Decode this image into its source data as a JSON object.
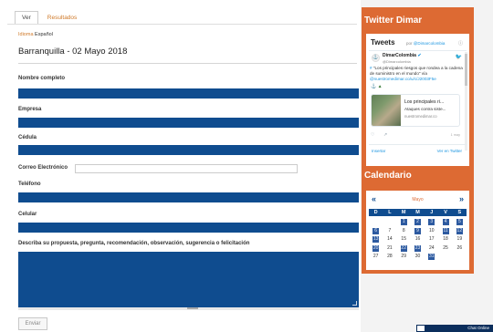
{
  "tabs": [
    {
      "label": "Ver",
      "active": true
    },
    {
      "label": "Resultados",
      "active": false
    }
  ],
  "languages": {
    "active": "Idioma",
    "other": "Español"
  },
  "form": {
    "title": "Barranquilla - 02 Mayo 2018",
    "fields": {
      "nombre": "Nombre completo",
      "empresa": "Empresa",
      "cedula": "Cédula",
      "correo": "Correo Electrónico",
      "telefono": "Teléfono",
      "celular": "Celular",
      "propuesta": "Describa su propuesta, pregunta, recomendación, observación, sugerencia o felicitación"
    },
    "submit_label": "Enviar",
    "field_color": "#0f4c8f"
  },
  "sidebar": {
    "accent": "#dd6a33",
    "twitter_heading": "Twitter Dimar",
    "calendar_heading": "Calendario"
  },
  "twitter": {
    "title": "Tweets",
    "by_prefix": "por",
    "by_handle": "@Dimarcolombia",
    "info_icon": "info-icon",
    "account_name": "DimarColombia",
    "account_handle": "@Dimarcolombia",
    "tweet_prefix": "#",
    "tweet_quote": "\"Los principales riesgos que rondea a la cadena de suministro en el mundo\"",
    "tweet_via": "vía",
    "tweet_link": "@nuestromedimar.co/u/c/J2003F5e",
    "card_title": "Los principales ri...",
    "card_subtitle": "Ataques contra siste...",
    "card_domain": "nuestromedimar.co",
    "date": "1 may",
    "embed_label": "Insertar",
    "view_label": "Ver en Twitter"
  },
  "calendar": {
    "month": "Mayo",
    "prev_label": "«",
    "next_label": "»",
    "days": [
      "D",
      "L",
      "M",
      "M",
      "J",
      "V",
      "S"
    ],
    "rows": [
      [
        {
          "d": "",
          "ev": false
        },
        {
          "d": "",
          "ev": false
        },
        {
          "d": "1",
          "ev": true
        },
        {
          "d": "2",
          "ev": true
        },
        {
          "d": "3",
          "ev": true
        },
        {
          "d": "4",
          "ev": true
        },
        {
          "d": "5",
          "ev": true
        }
      ],
      [
        {
          "d": "6",
          "ev": true
        },
        {
          "d": "7",
          "ev": false
        },
        {
          "d": "8",
          "ev": false
        },
        {
          "d": "9",
          "ev": true
        },
        {
          "d": "10",
          "ev": false
        },
        {
          "d": "11",
          "ev": true
        },
        {
          "d": "12",
          "ev": true
        }
      ],
      [
        {
          "d": "13",
          "ev": true
        },
        {
          "d": "14",
          "ev": false
        },
        {
          "d": "15",
          "ev": false
        },
        {
          "d": "16",
          "ev": false
        },
        {
          "d": "17",
          "ev": false
        },
        {
          "d": "18",
          "ev": false
        },
        {
          "d": "19",
          "ev": false
        }
      ],
      [
        {
          "d": "20",
          "ev": true
        },
        {
          "d": "21",
          "ev": false
        },
        {
          "d": "22",
          "ev": true
        },
        {
          "d": "23",
          "ev": true
        },
        {
          "d": "24",
          "ev": false
        },
        {
          "d": "25",
          "ev": false
        },
        {
          "d": "26",
          "ev": false
        }
      ],
      [
        {
          "d": "27",
          "ev": false
        },
        {
          "d": "28",
          "ev": false
        },
        {
          "d": "29",
          "ev": false
        },
        {
          "d": "30",
          "ev": false
        },
        {
          "d": "31",
          "ev": true
        },
        {
          "d": "",
          "ev": false
        },
        {
          "d": "",
          "ev": false
        }
      ]
    ]
  },
  "chat": {
    "label": "Chat Online"
  }
}
